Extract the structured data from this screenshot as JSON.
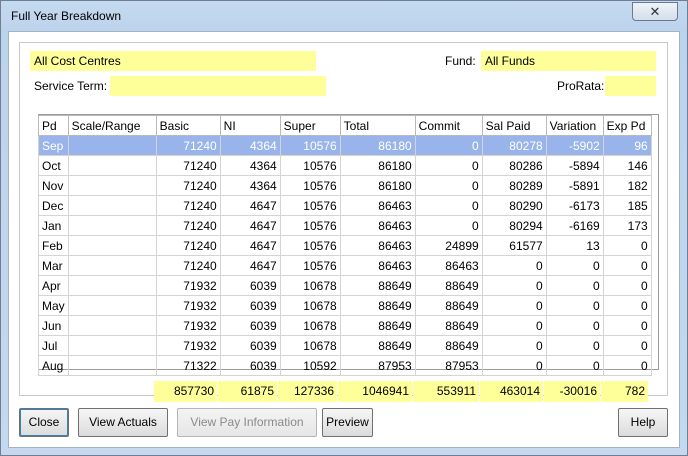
{
  "window": {
    "title": "Full Year Breakdown",
    "close_glyph": "✕"
  },
  "filters": {
    "cost_centre": "All Cost Centres",
    "fund_label": "Fund:",
    "fund_value": "All Funds",
    "service_term_label": "Service Term:",
    "service_term_value": "",
    "prorata_label": "ProRata:",
    "prorata_value": ""
  },
  "table": {
    "columns": [
      "Pd",
      "Scale/Range",
      "Basic",
      "NI",
      "Super",
      "Total",
      "Commit",
      "Sal Paid",
      "Variation",
      "Exp Pd"
    ],
    "rows": [
      [
        "Sep",
        "",
        "71240",
        "4364",
        "10576",
        "86180",
        "0",
        "80278",
        "-5902",
        "96"
      ],
      [
        "Oct",
        "",
        "71240",
        "4364",
        "10576",
        "86180",
        "0",
        "80286",
        "-5894",
        "146"
      ],
      [
        "Nov",
        "",
        "71240",
        "4364",
        "10576",
        "86180",
        "0",
        "80289",
        "-5891",
        "182"
      ],
      [
        "Dec",
        "",
        "71240",
        "4647",
        "10576",
        "86463",
        "0",
        "80290",
        "-6173",
        "185"
      ],
      [
        "Jan",
        "",
        "71240",
        "4647",
        "10576",
        "86463",
        "0",
        "80294",
        "-6169",
        "173"
      ],
      [
        "Feb",
        "",
        "71240",
        "4647",
        "10576",
        "86463",
        "24899",
        "61577",
        "13",
        "0"
      ],
      [
        "Mar",
        "",
        "71240",
        "4647",
        "10576",
        "86463",
        "86463",
        "0",
        "0",
        "0"
      ],
      [
        "Apr",
        "",
        "71932",
        "6039",
        "10678",
        "88649",
        "88649",
        "0",
        "0",
        "0"
      ],
      [
        "May",
        "",
        "71932",
        "6039",
        "10678",
        "88649",
        "88649",
        "0",
        "0",
        "0"
      ],
      [
        "Jun",
        "",
        "71932",
        "6039",
        "10678",
        "88649",
        "88649",
        "0",
        "0",
        "0"
      ],
      [
        "Jul",
        "",
        "71932",
        "6039",
        "10678",
        "88649",
        "88649",
        "0",
        "0",
        "0"
      ],
      [
        "Aug",
        "",
        "71322",
        "6039",
        "10592",
        "87953",
        "87953",
        "0",
        "0",
        "0"
      ]
    ],
    "selected_row": 0,
    "totals": [
      "857730",
      "61875",
      "127336",
      "1046941",
      "553911",
      "463014",
      "-30016",
      "782"
    ]
  },
  "buttons": {
    "close": "Close",
    "view_actuals": "View Actuals",
    "view_pay_information": "View Pay Information",
    "preview": "Preview",
    "help": "Help"
  },
  "colors": {
    "highlight_field": "#ffff9a",
    "selected_row": "#99b4ea"
  }
}
